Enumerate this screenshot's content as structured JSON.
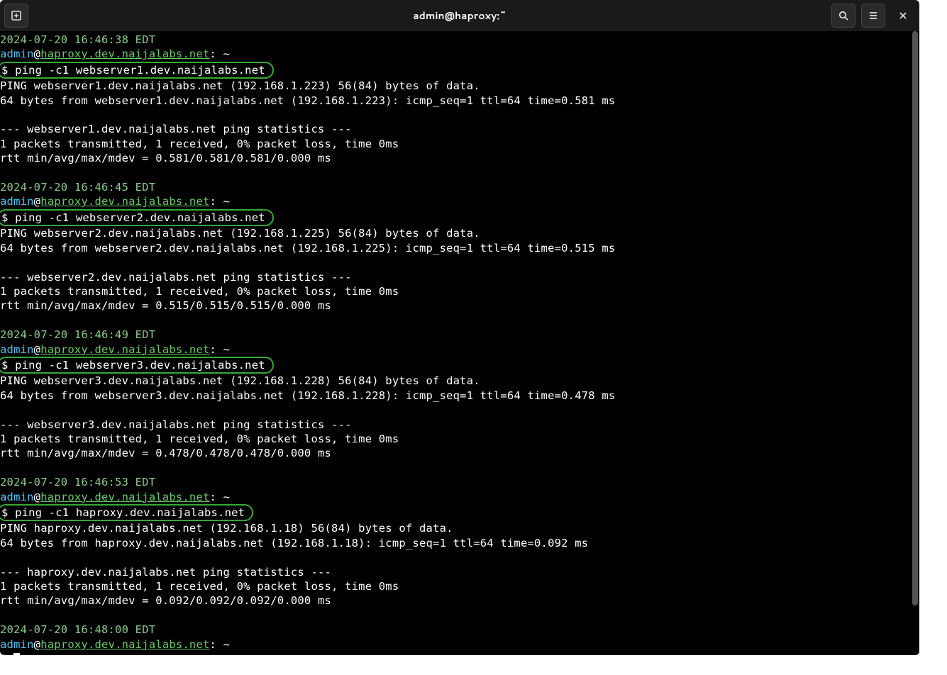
{
  "titlebar": {
    "title": "admin@haproxy:~"
  },
  "prompt": {
    "user": "admin",
    "at": "@",
    "host": "haproxy.dev.naijalabs.net",
    "suffix": ": ~",
    "symbol": "$ "
  },
  "blocks": [
    {
      "timestamp": "2024-07-20 16:46:38 EDT",
      "command": "ping -c1 webserver1.dev.naijalabs.net",
      "output": [
        "PING webserver1.dev.naijalabs.net (192.168.1.223) 56(84) bytes of data.",
        "64 bytes from webserver1.dev.naijalabs.net (192.168.1.223): icmp_seq=1 ttl=64 time=0.581 ms",
        "",
        "--- webserver1.dev.naijalabs.net ping statistics ---",
        "1 packets transmitted, 1 received, 0% packet loss, time 0ms",
        "rtt min/avg/max/mdev = 0.581/0.581/0.581/0.000 ms"
      ]
    },
    {
      "timestamp": "2024-07-20 16:46:45 EDT",
      "command": "ping -c1 webserver2.dev.naijalabs.net",
      "output": [
        "PING webserver2.dev.naijalabs.net (192.168.1.225) 56(84) bytes of data.",
        "64 bytes from webserver2.dev.naijalabs.net (192.168.1.225): icmp_seq=1 ttl=64 time=0.515 ms",
        "",
        "--- webserver2.dev.naijalabs.net ping statistics ---",
        "1 packets transmitted, 1 received, 0% packet loss, time 0ms",
        "rtt min/avg/max/mdev = 0.515/0.515/0.515/0.000 ms"
      ]
    },
    {
      "timestamp": "2024-07-20 16:46:49 EDT",
      "command": "ping -c1 webserver3.dev.naijalabs.net",
      "output": [
        "PING webserver3.dev.naijalabs.net (192.168.1.228) 56(84) bytes of data.",
        "64 bytes from webserver3.dev.naijalabs.net (192.168.1.228): icmp_seq=1 ttl=64 time=0.478 ms",
        "",
        "--- webserver3.dev.naijalabs.net ping statistics ---",
        "1 packets transmitted, 1 received, 0% packet loss, time 0ms",
        "rtt min/avg/max/mdev = 0.478/0.478/0.478/0.000 ms"
      ]
    },
    {
      "timestamp": "2024-07-20 16:46:53 EDT",
      "command": "ping -c1 haproxy.dev.naijalabs.net",
      "output": [
        "PING haproxy.dev.naijalabs.net (192.168.1.18) 56(84) bytes of data.",
        "64 bytes from haproxy.dev.naijalabs.net (192.168.1.18): icmp_seq=1 ttl=64 time=0.092 ms",
        "",
        "--- haproxy.dev.naijalabs.net ping statistics ---",
        "1 packets transmitted, 1 received, 0% packet loss, time 0ms",
        "rtt min/avg/max/mdev = 0.092/0.092/0.092/0.000 ms"
      ]
    }
  ],
  "current": {
    "timestamp": "2024-07-20 16:48:00 EDT"
  }
}
